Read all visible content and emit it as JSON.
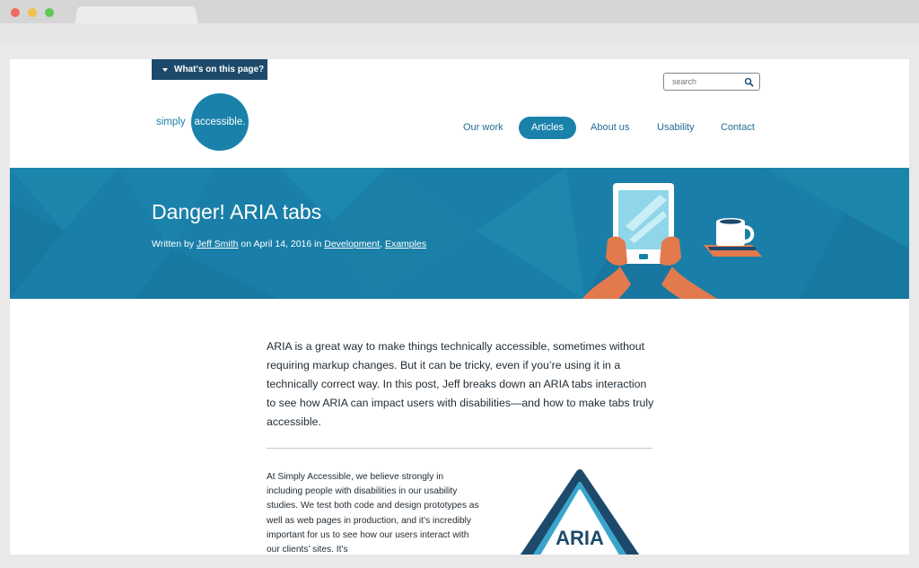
{
  "page": {
    "skip_link": "What's on this page?",
    "search_placeholder": "search"
  },
  "logo": {
    "left_word": "simply",
    "circle_word": "accessible."
  },
  "nav": {
    "items": [
      {
        "label": "Our work"
      },
      {
        "label": "Articles",
        "active": true
      },
      {
        "label": "About us"
      },
      {
        "label": "Usability"
      },
      {
        "label": "Contact"
      }
    ]
  },
  "hero": {
    "title": "Danger! ARIA tabs",
    "byline": {
      "written_by": "Written by",
      "author": "Jeff Smith",
      "on": "on April 14, 2016 in",
      "category1": "Development",
      "comma": ",",
      "category2": "Examples"
    }
  },
  "article": {
    "intro": "ARIA is a great way to make things technically accessible, sometimes without requiring markup changes. But it can be tricky, even if you’re using it in a technically correct way. In this post, Jeff breaks down an ARIA tabs interaction to see how ARIA can impact users with disabilities—and how to make tabs truly accessible.",
    "body": "At Simply Accessible, we believe strongly in including people with disabilities in our usability studies. We test both code and design prototypes as well as web pages in production, and it’s incredibly important for us to see how our users interact with our clients’ sites. It’s",
    "warning_label": "ARIA"
  },
  "colors": {
    "brand": "#1a82aa",
    "hero": "#1a7fa8",
    "dark": "#1d4a6b",
    "hand": "#e27a4e"
  },
  "icons": {
    "search": "search-icon",
    "skip": "triangle-down-icon"
  }
}
